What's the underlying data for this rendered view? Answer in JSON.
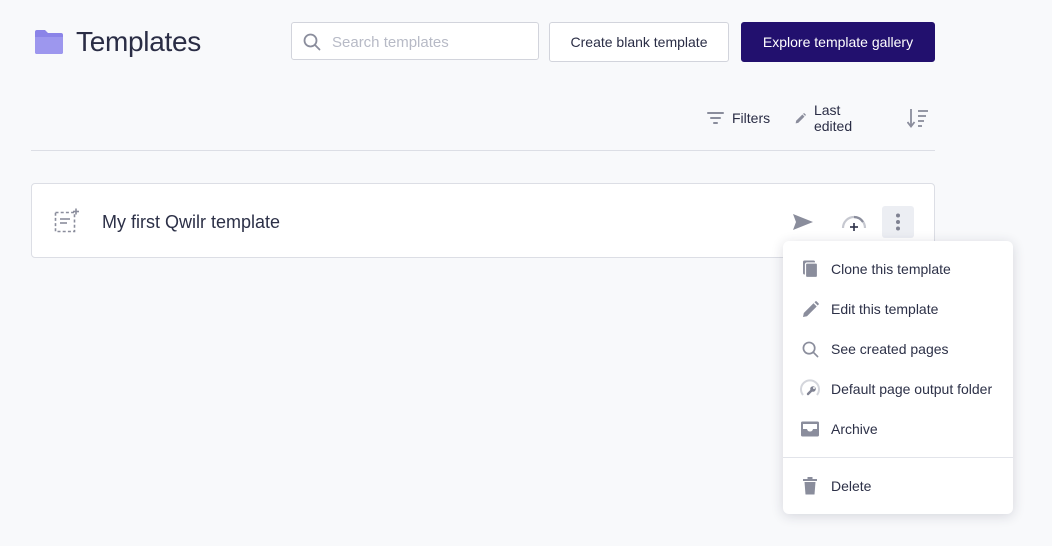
{
  "header": {
    "title": "Templates",
    "search_placeholder": "Search templates",
    "create_blank_label": "Create blank template",
    "explore_gallery_label": "Explore template gallery"
  },
  "toolbar": {
    "filters_label": "Filters",
    "sort_label": "Last edited"
  },
  "templates": [
    {
      "name": "My first Qwilr template"
    }
  ],
  "context_menu": {
    "items": [
      {
        "label": "Clone this template",
        "icon": "clone-icon"
      },
      {
        "label": "Edit this template",
        "icon": "pencil-icon"
      },
      {
        "label": "See created pages",
        "icon": "search-icon"
      },
      {
        "label": "Default page output folder",
        "icon": "folder-gear-icon"
      },
      {
        "label": "Archive",
        "icon": "archive-icon"
      },
      {
        "label": "Delete",
        "icon": "trash-icon"
      }
    ]
  },
  "colors": {
    "primary": "#22106e",
    "folder": "#8b84e8",
    "icon": "#8a8d9c",
    "background": "#f8f9fb"
  }
}
